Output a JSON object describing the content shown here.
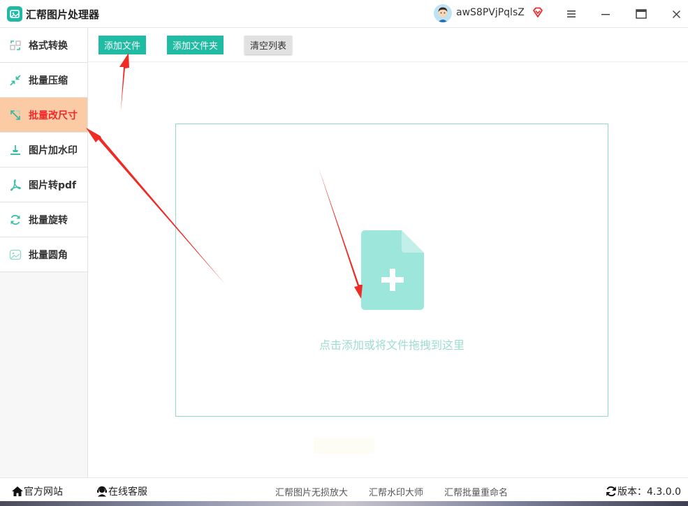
{
  "app": {
    "title": "汇帮图片处理器",
    "user_name": "awS8PVjPqlsZ",
    "accent_color": "#1fbba3"
  },
  "sidebar": {
    "items": [
      {
        "label": "格式转换",
        "icon": "format-convert-icon",
        "active": false
      },
      {
        "label": "批量压缩",
        "icon": "compress-icon",
        "active": false
      },
      {
        "label": "批量改尺寸",
        "icon": "resize-icon",
        "active": true
      },
      {
        "label": "图片加水印",
        "icon": "watermark-icon",
        "active": false
      },
      {
        "label": "图片转pdf",
        "icon": "pdf-icon",
        "active": false
      },
      {
        "label": "批量旋转",
        "icon": "rotate-icon",
        "active": false
      },
      {
        "label": "批量圆角",
        "icon": "round-corner-icon",
        "active": false
      }
    ]
  },
  "toolbar": {
    "add_file_label": "添加文件",
    "add_folder_label": "添加文件夹",
    "clear_list_label": "清空列表"
  },
  "dropzone": {
    "hint": "点击添加或将文件拖拽到这里",
    "icon": "file-add-icon"
  },
  "footer": {
    "website_label": "官方网站",
    "support_label": "在线客服",
    "links": [
      "汇帮图片无损放大",
      "汇帮水印大师",
      "汇帮批量重命名"
    ],
    "version_label": "版本：4.3.0.0"
  }
}
